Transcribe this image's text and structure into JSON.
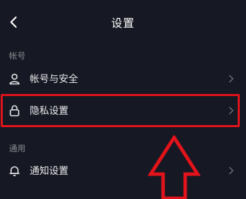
{
  "header": {
    "title": "设置"
  },
  "sections": {
    "account": {
      "label": "帐号",
      "items": [
        {
          "label": "帐号与安全",
          "icon": "person-icon"
        },
        {
          "label": "隐私设置",
          "icon": "lock-icon"
        }
      ]
    },
    "general": {
      "label": "通用",
      "items": [
        {
          "label": "通知设置",
          "icon": "bell-icon"
        }
      ]
    }
  },
  "annotation": {
    "highlight_color": "#e3131b",
    "arrow_color": "#e3131b"
  }
}
